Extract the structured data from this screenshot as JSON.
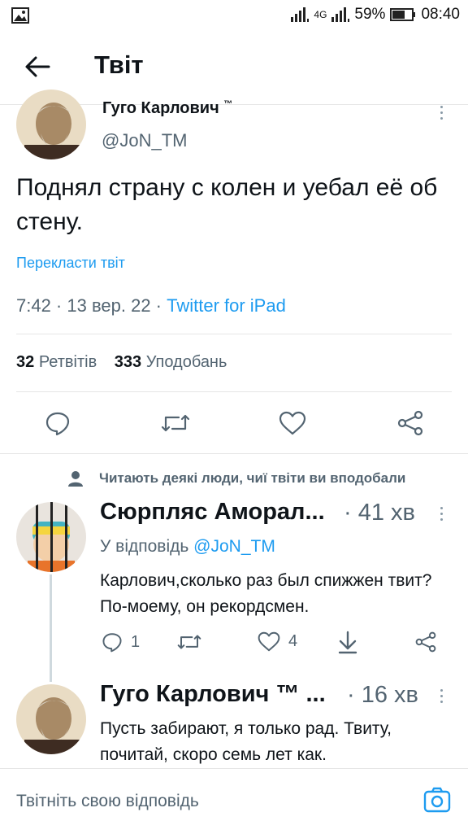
{
  "status_bar": {
    "network": "4G",
    "battery": "59%",
    "time": "08:40"
  },
  "header": {
    "title": "Твіт"
  },
  "main_tweet": {
    "author_name": "Гуго Карлович",
    "author_tm": "™",
    "handle": "@JoN_TM",
    "text": "Поднял страну с колен и уебал её об стену.",
    "translate_label": "Перекласти твіт",
    "meta_time": "7:42 · 13 вер. 22 · ",
    "meta_client": "Twitter for iPad",
    "retweets_count": "32",
    "retweets_label": "Ретвітів",
    "likes_count": "333",
    "likes_label": "Уподобань"
  },
  "social_context": "Читають деякі люди, чиї твіти ви вподобали",
  "replies": [
    {
      "author_name": "Сюрпляс Аморал...",
      "time": "· 41 хв",
      "reply_to_prefix": "У відповідь ",
      "reply_to_handle": "@JoN_TM",
      "text": "Карлович,сколько раз был спижжен твит? По-моему, он рекордсмен.",
      "reply_count": "1",
      "like_count": "4"
    },
    {
      "author_name": "Гуго Карлович ™ ...",
      "time": "· 16 хв",
      "text": "Пусть забирают, я только рад. Твиту, почитай, скоро семь лет как."
    }
  ],
  "compose": {
    "placeholder": "Твітніть свою відповідь"
  },
  "colors": {
    "accent": "#1d9bf0",
    "text": "#0f1419",
    "secondary": "#536471"
  }
}
